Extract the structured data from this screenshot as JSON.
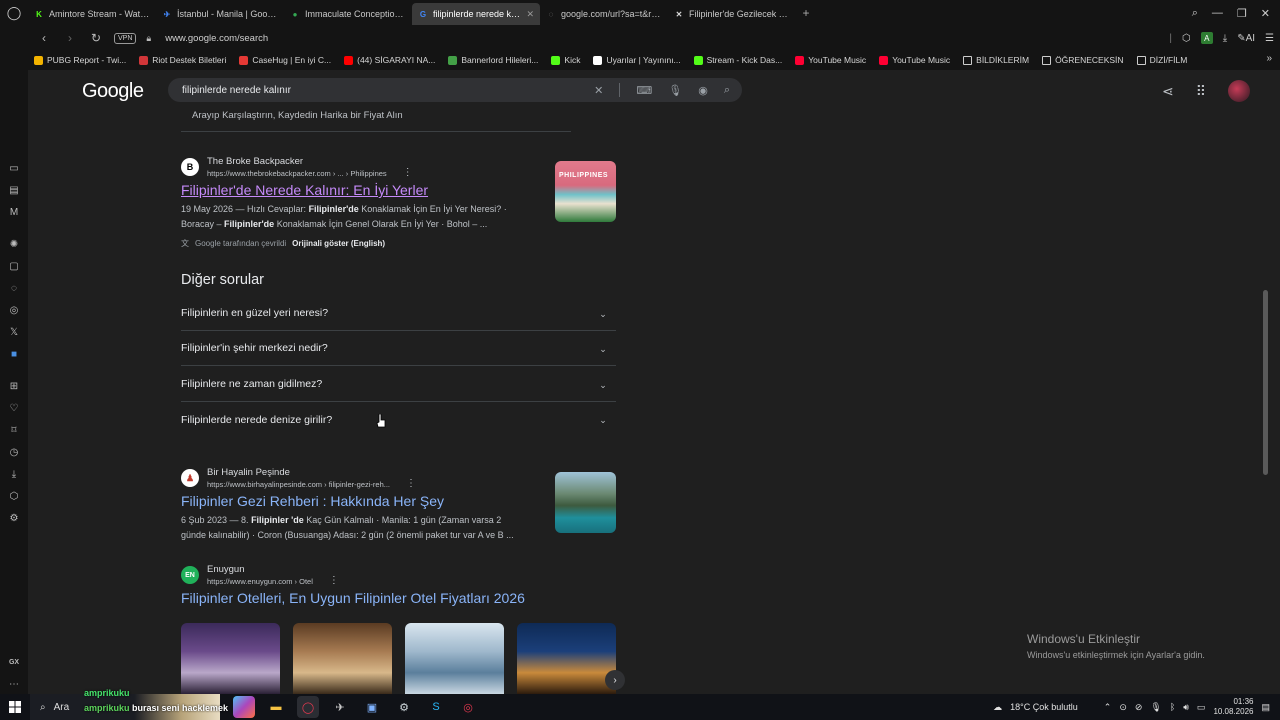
{
  "browser": {
    "tabs": [
      {
        "title": "Amintore Stream - Watch L",
        "color": "#53fc18",
        "glyph": "K",
        "active": false
      },
      {
        "title": "İstanbul - Manila | Google",
        "color": "#4285f4",
        "glyph": "✈",
        "active": false
      },
      {
        "title": "Immaculate Conception Ca",
        "color": "#34a853",
        "glyph": "●",
        "active": false
      },
      {
        "title": "filipinlerde nerede kalınır -",
        "color": "#4285f4",
        "glyph": "G",
        "active": true
      },
      {
        "title": "google.com/url?sa=t&rct=j",
        "color": "#888888",
        "glyph": "◌",
        "active": false
      },
      {
        "title": "Filipinler'de Gezilecek Yerle",
        "color": "#d9d9d9",
        "glyph": "✕",
        "active": false
      }
    ],
    "url": "www.google.com/search",
    "vpn_label": "VPN",
    "ai_label": "AI",
    "bookmarks": [
      {
        "label": "PUBG Report - Twi...",
        "color": "#f4b400"
      },
      {
        "label": "Riot Destek Biletleri",
        "color": "#d13639"
      },
      {
        "label": "CaseHug | En iyi C...",
        "color": "#e53935"
      },
      {
        "label": "(44) SİGARAYI NA...",
        "color": "#ff0000"
      },
      {
        "label": "Bannerlord Hileleri...",
        "color": "#43a047"
      },
      {
        "label": "Kick",
        "color": "#53fc18"
      },
      {
        "label": "Uyarılar | Yayınını...",
        "color": "#ffffff"
      },
      {
        "label": "Stream - Kick Das...",
        "color": "#53fc18"
      },
      {
        "label": "YouTube Music",
        "color": "#ff0033"
      },
      {
        "label": "YouTube Music",
        "color": "#ff0033"
      },
      {
        "label": "BİLDİKLERİM",
        "color": "folder"
      },
      {
        "label": "ÖĞRENECEKSİN",
        "color": "folder"
      },
      {
        "label": "DİZİ/FİLM",
        "color": "folder"
      }
    ],
    "sidebar_bottom_label": "GX"
  },
  "google": {
    "logo": "Google",
    "query": "filipinlerde nerede kalınır",
    "prev_snippet": "Arayıp Karşılaştırın, Kaydedin Harika bir Fiyat Alın",
    "results": [
      {
        "source_name": "The Broke Backpacker",
        "source_url": "https://www.thebrokebackpacker.com › ... › Philippines",
        "icon_letter": "B",
        "title": "Filipinler'de Nerede Kalınır: En İyi Yerler",
        "snippet_parts": [
          "19 May 2026 — Hızlı Cevaplar: ",
          "Filipinler'de",
          " Konaklamak İçin En İyi Yer Neresi? · Boracay – ",
          "Filipinler'de",
          " Konaklamak İçin Genel Olarak En İyi Yer · Bohol – ..."
        ],
        "translated_note": "Google tarafından çevrildi",
        "show_original": "Orijinali göster (English)"
      },
      {
        "source_name": "Bir Hayalin Peşinde",
        "source_url": "https://www.birhayalinpesinde.com › filipinler-gezi-reh...",
        "title": "Filipinler Gezi Rehberi : Hakkında Her Şey",
        "snippet_parts": [
          "6 Şub 2023 — 8. ",
          "Filipinler 'de",
          " Kaç Gün Kalmalı · Manila: 1 gün (Zaman varsa 2 günde kalınabilir) · Coron (Busuanga) Adası: 2 gün (2 önemli paket tur var A ve B ..."
        ]
      },
      {
        "source_name": "Enuygun",
        "source_url": "https://www.enuygun.com › Otel",
        "icon_letter": "EN",
        "title": "Filipinler Otelleri, En Uygun Filipinler Otel Fiyatları 2026"
      }
    ],
    "thumb_text": "PHILIPPINES",
    "paa": {
      "title": "Diğer sorular",
      "questions": [
        "Filipinlerin en güzel yeri neresi?",
        "Filipinler'in şehir merkezi nedir?",
        "Filipinlere ne zaman gidilmez?",
        "Filipinlerde nerede denize girilir?"
      ]
    }
  },
  "watermark": {
    "line1": "Windows'u Etkinleştir",
    "line2": "Windows'u etkinleştirmek için Ayarlar'a gidin."
  },
  "taskbar": {
    "search_label": "Ara",
    "overlay_line1": "amprikuku",
    "overlay_line2_name": "amprikuku",
    "overlay_line2_rest": " burası seni hacklemek",
    "weather": "18°C  Çok bulutlu",
    "time": "01:36",
    "date": "10.08.2026"
  }
}
